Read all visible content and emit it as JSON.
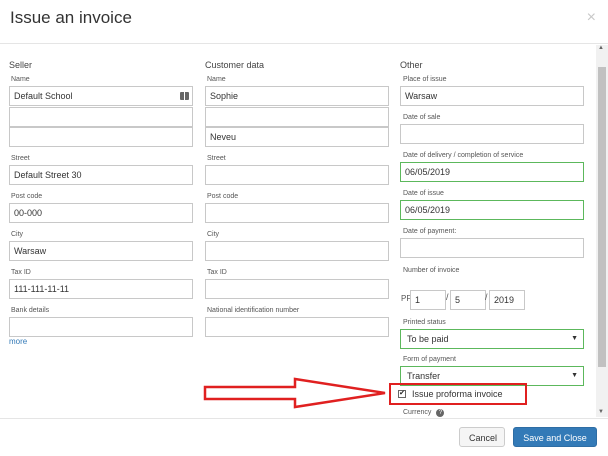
{
  "dialog": {
    "title": "Issue an invoice",
    "close_icon": "×"
  },
  "seller": {
    "heading": "Seller",
    "name_label": "Name",
    "name_value": "Default School",
    "street_label": "Street",
    "street_value": "Default Street 30",
    "postcode_label": "Post code",
    "postcode_value": "00-000",
    "city_label": "City",
    "city_value": "Warsaw",
    "taxid_label": "Tax ID",
    "taxid_value": "111-111-11-11",
    "bank_label": "Bank details",
    "more_link": "more"
  },
  "customer": {
    "heading": "Customer data",
    "name_label": "Name",
    "first_name": "Sophie",
    "last_name": "Neveu",
    "street_label": "Street",
    "postcode_label": "Post code",
    "city_label": "City",
    "taxid_label": "Tax ID",
    "nin_label": "National identification number"
  },
  "other": {
    "heading": "Other",
    "place_label": "Place of issue",
    "place_value": "Warsaw",
    "sale_date_label": "Date of sale",
    "delivery_label": "Date of delivery / completion of service",
    "delivery_value": "06/05/2019",
    "issue_date_label": "Date of issue",
    "issue_date_value": "06/05/2019",
    "payment_date_label": "Date of payment:",
    "invoice_number_label": "Number of invoice",
    "pf_prefix": "PF",
    "pf_num1": "1",
    "pf_num2": "5",
    "pf_year": "2019",
    "status_label": "Printed status",
    "status_value": "To be paid",
    "payment_form_label": "Form of payment",
    "payment_form_value": "Transfer",
    "proforma_label": "Issue proforma invoice",
    "currency_label": "Currency"
  },
  "footer": {
    "cancel_label": "Cancel",
    "save_label": "Save and Close"
  },
  "colors": {
    "accent": "#337ab7",
    "valid": "#5cb85c",
    "highlight": "#e02020"
  }
}
